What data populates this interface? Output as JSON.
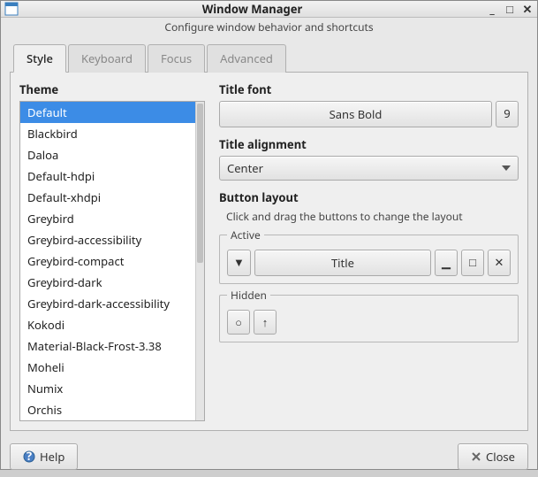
{
  "window": {
    "title": "Window Manager",
    "subtitle": "Configure window behavior and shortcuts"
  },
  "tabs": {
    "items": [
      "Style",
      "Keyboard",
      "Focus",
      "Advanced"
    ],
    "active": 0
  },
  "theme": {
    "title": "Theme",
    "items": [
      "Default",
      "Blackbird",
      "Daloa",
      "Default-hdpi",
      "Default-xhdpi",
      "Greybird",
      "Greybird-accessibility",
      "Greybird-compact",
      "Greybird-dark",
      "Greybird-dark-accessibility",
      "Kokodi",
      "Material-Black-Frost-3.38",
      "Moheli",
      "Numix",
      "Orchis"
    ],
    "selected": 0
  },
  "title_font": {
    "title": "Title font",
    "name": "Sans Bold",
    "size": "9"
  },
  "title_alignment": {
    "title": "Title alignment",
    "value": "Center"
  },
  "button_layout": {
    "title": "Button layout",
    "hint": "Click and drag the buttons to change the layout",
    "active_label": "Active",
    "hidden_label": "Hidden",
    "title_button": "Title"
  },
  "footer": {
    "help": "Help",
    "close": "Close"
  }
}
